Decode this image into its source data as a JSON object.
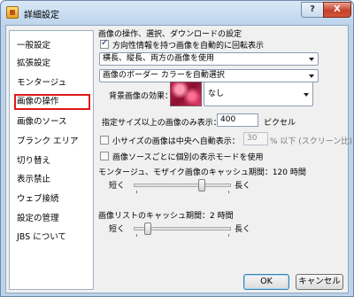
{
  "window": {
    "title": "詳細設定",
    "help_label": "?",
    "close_label": "X"
  },
  "sidebar": {
    "items": [
      {
        "label": "一般設定",
        "selected": false
      },
      {
        "label": "拡張設定",
        "selected": false
      },
      {
        "label": "モンタージュ",
        "selected": false
      },
      {
        "label": "画像の操作",
        "selected": true
      },
      {
        "label": "画像のソース",
        "selected": false
      },
      {
        "label": "ブランク エリア",
        "selected": false
      },
      {
        "label": "切り替え",
        "selected": false
      },
      {
        "label": "表示禁止",
        "selected": false
      },
      {
        "label": "ウェブ接続",
        "selected": false
      },
      {
        "label": "設定の管理",
        "selected": false
      },
      {
        "label": "JBS について",
        "selected": false
      }
    ]
  },
  "panel": {
    "section_title": "画像の操作、選択、ダウンロードの設定",
    "auto_rotate": {
      "label": "方向性情報を持つ画像を自動的に回転表示",
      "checked": true
    },
    "orientation_combo": {
      "value": "横長、縦長、両方の画像を使用"
    },
    "border_color_combo": {
      "value": "画像のボーダー カラーを自動選択"
    },
    "background_effect": {
      "label": "背景画像の効果：",
      "value": "なし"
    },
    "min_size": {
      "label": "指定サイズ以上の画像のみ表示：",
      "value": "400",
      "unit": "ピクセル"
    },
    "small_center": {
      "label": "小サイズの画像は中央へ自動表示：",
      "checked": false,
      "value": "30",
      "suffix": "% 以下 (スクリーン比)"
    },
    "per_source_mode": {
      "label": "画像ソースごとに個別の表示モードを使用",
      "checked": false
    },
    "montage_cache": {
      "label": "モンタージュ、モザイク画像のキャッシュ期間：120 時間",
      "short_label": "短く",
      "long_label": "長く",
      "level_percent": 72
    },
    "list_cache": {
      "label": "画像リストのキャッシュ期間：2 時間",
      "short_label": "短く",
      "long_label": "長く",
      "level_percent": 12
    }
  },
  "footer": {
    "ok_label": "OK",
    "cancel_label": "キャンセル"
  }
}
